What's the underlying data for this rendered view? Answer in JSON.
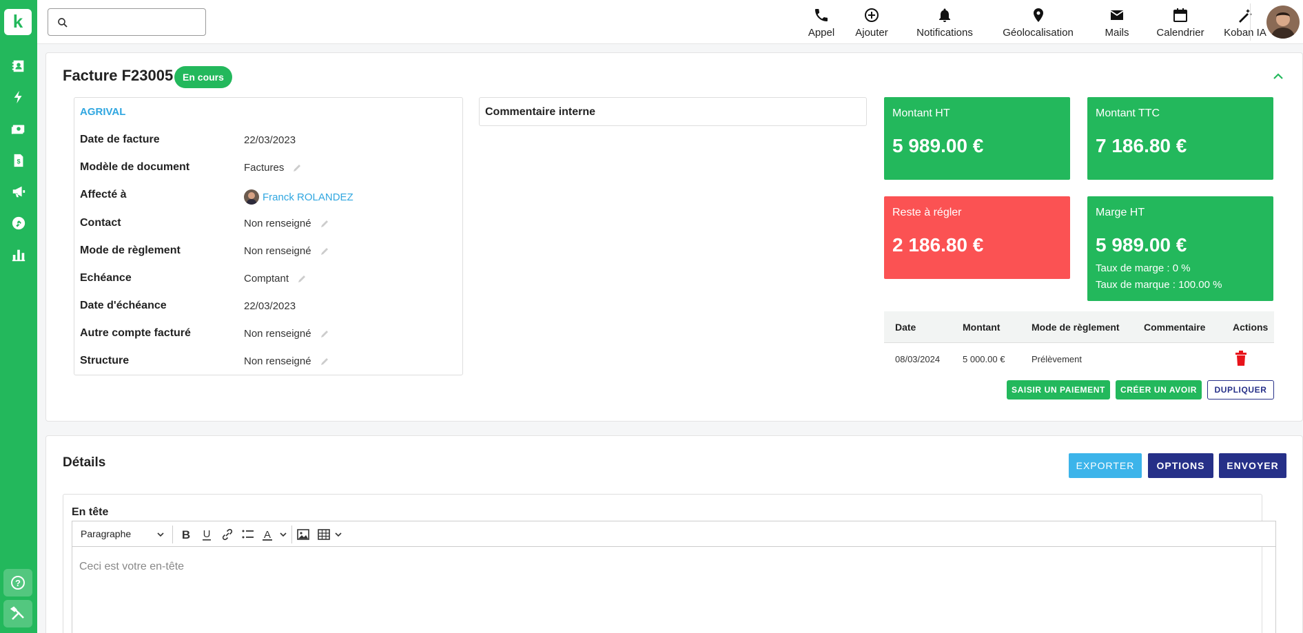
{
  "app": {
    "logo_letter": "k"
  },
  "search": {
    "placeholder": ""
  },
  "topbar": {
    "actions": [
      {
        "label": "Appel",
        "icon": "phone-icon"
      },
      {
        "label": "Ajouter",
        "icon": "plus-circle-icon"
      },
      {
        "label": "Notifications",
        "icon": "bell-icon"
      },
      {
        "label": "Géolocalisation",
        "icon": "map-pin-icon"
      },
      {
        "label": "Mails",
        "icon": "mail-icon"
      },
      {
        "label": "Calendrier",
        "icon": "calendar-icon"
      },
      {
        "label": "Koban IA",
        "icon": "magic-wand-icon"
      }
    ]
  },
  "sidebar": {
    "items": [
      "contacts-icon",
      "lightning-icon",
      "money-icon",
      "invoice-icon",
      "megaphone-icon",
      "wrench-icon",
      "chart-icon"
    ],
    "bottom": [
      "help-icon",
      "tools-icon"
    ]
  },
  "invoice": {
    "title": "Facture F23005",
    "status": "En cours",
    "company": "AGRIVAL",
    "fields": [
      {
        "label": "Date de facture",
        "value": "22/03/2023",
        "editable": false
      },
      {
        "label": "Modèle de document",
        "value": "Factures",
        "editable": true
      },
      {
        "label": "Affecté à",
        "value": "Franck ROLANDEZ",
        "editable": false,
        "link": true
      },
      {
        "label": "Contact",
        "value": "Non renseigné",
        "editable": true
      },
      {
        "label": "Mode de règlement",
        "value": "Non renseigné",
        "editable": true
      },
      {
        "label": "Echéance",
        "value": "Comptant",
        "editable": true
      },
      {
        "label": "Date d'échéance",
        "value": "22/03/2023",
        "editable": false
      },
      {
        "label": "Autre compte facturé",
        "value": "Non renseigné",
        "editable": true
      },
      {
        "label": "Structure",
        "value": "Non renseigné",
        "editable": true
      }
    ],
    "comment_label": "Commentaire interne"
  },
  "stats": {
    "montant_ht": {
      "label": "Montant HT",
      "value": "5 989.00 €"
    },
    "montant_ttc": {
      "label": "Montant TTC",
      "value": "7 186.80 €"
    },
    "reste": {
      "label": "Reste à régler",
      "value": "2 186.80 €"
    },
    "marge": {
      "label": "Marge HT",
      "value": "5 989.00 €",
      "taux_marge": "Taux de marge : 0 %",
      "taux_marque": "Taux de marque : 100.00 %"
    }
  },
  "colors": {
    "green": "#23b85c",
    "red": "#fb5253",
    "navy": "#263088",
    "blue": "#3cb4ea",
    "link": "#2fa6e0"
  },
  "payments": {
    "headers": [
      "Date",
      "Montant",
      "Mode de règlement",
      "Commentaire",
      "Actions"
    ],
    "rows": [
      {
        "date": "08/03/2024",
        "montant": "5 000.00 €",
        "mode": "Prélèvement",
        "commentaire": ""
      }
    ]
  },
  "invoice_actions": {
    "saisir": "SAISIR UN PAIEMENT",
    "avoir": "CRÉER UN AVOIR",
    "dupliquer": "DUPLIQUER"
  },
  "details": {
    "title": "Détails",
    "exporter": "EXPORTER",
    "options": "OPTIONS",
    "envoyer": "ENVOYER",
    "editor_label": "En tête",
    "paragraph_select": "Paragraphe",
    "placeholder": "Ceci est votre en-tête"
  }
}
